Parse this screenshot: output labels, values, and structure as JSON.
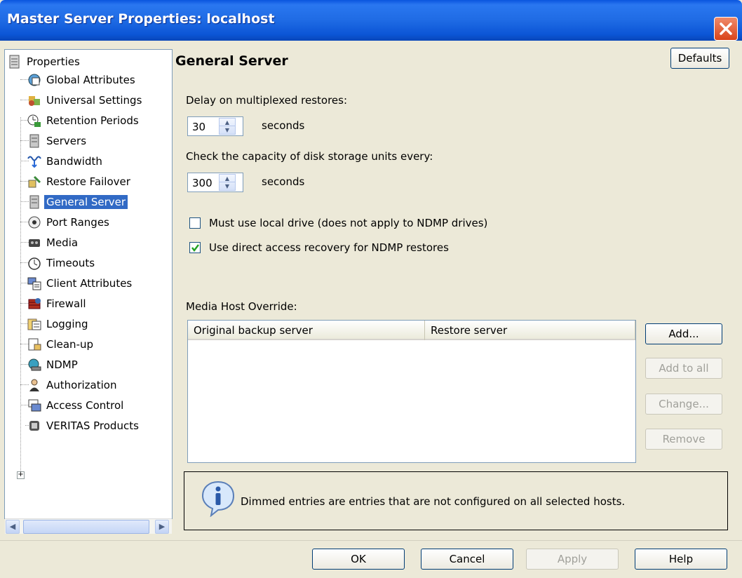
{
  "window": {
    "title": "Master Server Properties: localhost"
  },
  "tree": {
    "root_label": "Properties",
    "items": [
      {
        "label": "Global Attributes",
        "icon": "globe-calendar-icon"
      },
      {
        "label": "Universal Settings",
        "icon": "puzzle-gear-icon"
      },
      {
        "label": "Retention Periods",
        "icon": "clock-icon"
      },
      {
        "label": "Servers",
        "icon": "server-icon"
      },
      {
        "label": "Bandwidth",
        "icon": "bandwidth-icon"
      },
      {
        "label": "Restore Failover",
        "icon": "restore-failover-icon"
      },
      {
        "label": "General Server",
        "icon": "server-icon",
        "selected": true
      },
      {
        "label": "Port Ranges",
        "icon": "port-icon"
      },
      {
        "label": "Media",
        "icon": "media-icon"
      },
      {
        "label": "Timeouts",
        "icon": "timer-icon"
      },
      {
        "label": "Client Attributes",
        "icon": "client-icon"
      },
      {
        "label": "Firewall",
        "icon": "firewall-icon"
      },
      {
        "label": "Logging",
        "icon": "logging-icon"
      },
      {
        "label": "Clean-up",
        "icon": "cleanup-icon"
      },
      {
        "label": "NDMP",
        "icon": "ndmp-icon"
      },
      {
        "label": "Authorization",
        "icon": "authorization-icon"
      },
      {
        "label": "Access Control",
        "icon": "access-control-icon"
      },
      {
        "label": "VERITAS Products",
        "icon": "veritas-icon"
      }
    ]
  },
  "panel": {
    "title": "General Server",
    "defaults_label": "Defaults",
    "delay_label": "Delay on multiplexed restores:",
    "delay_value": "30",
    "delay_unit": "seconds",
    "capacity_label": "Check the capacity of disk storage units every:",
    "capacity_value": "300",
    "capacity_unit": "seconds",
    "local_drive_label": "Must use local drive (does not apply to NDMP drives)",
    "local_drive_checked": false,
    "direct_access_label": "Use direct access recovery for NDMP restores",
    "direct_access_checked": true,
    "media_host_label": "Media Host Override:",
    "columns": [
      "Original backup server",
      "Restore server"
    ],
    "add_label": "Add...",
    "add_all_label": "Add to all",
    "change_label": "Change...",
    "remove_label": "Remove",
    "info_text": "Dimmed entries are entries that are not configured on all selected hosts."
  },
  "footer": {
    "ok": "OK",
    "cancel": "Cancel",
    "apply": "Apply",
    "help": "Help"
  }
}
